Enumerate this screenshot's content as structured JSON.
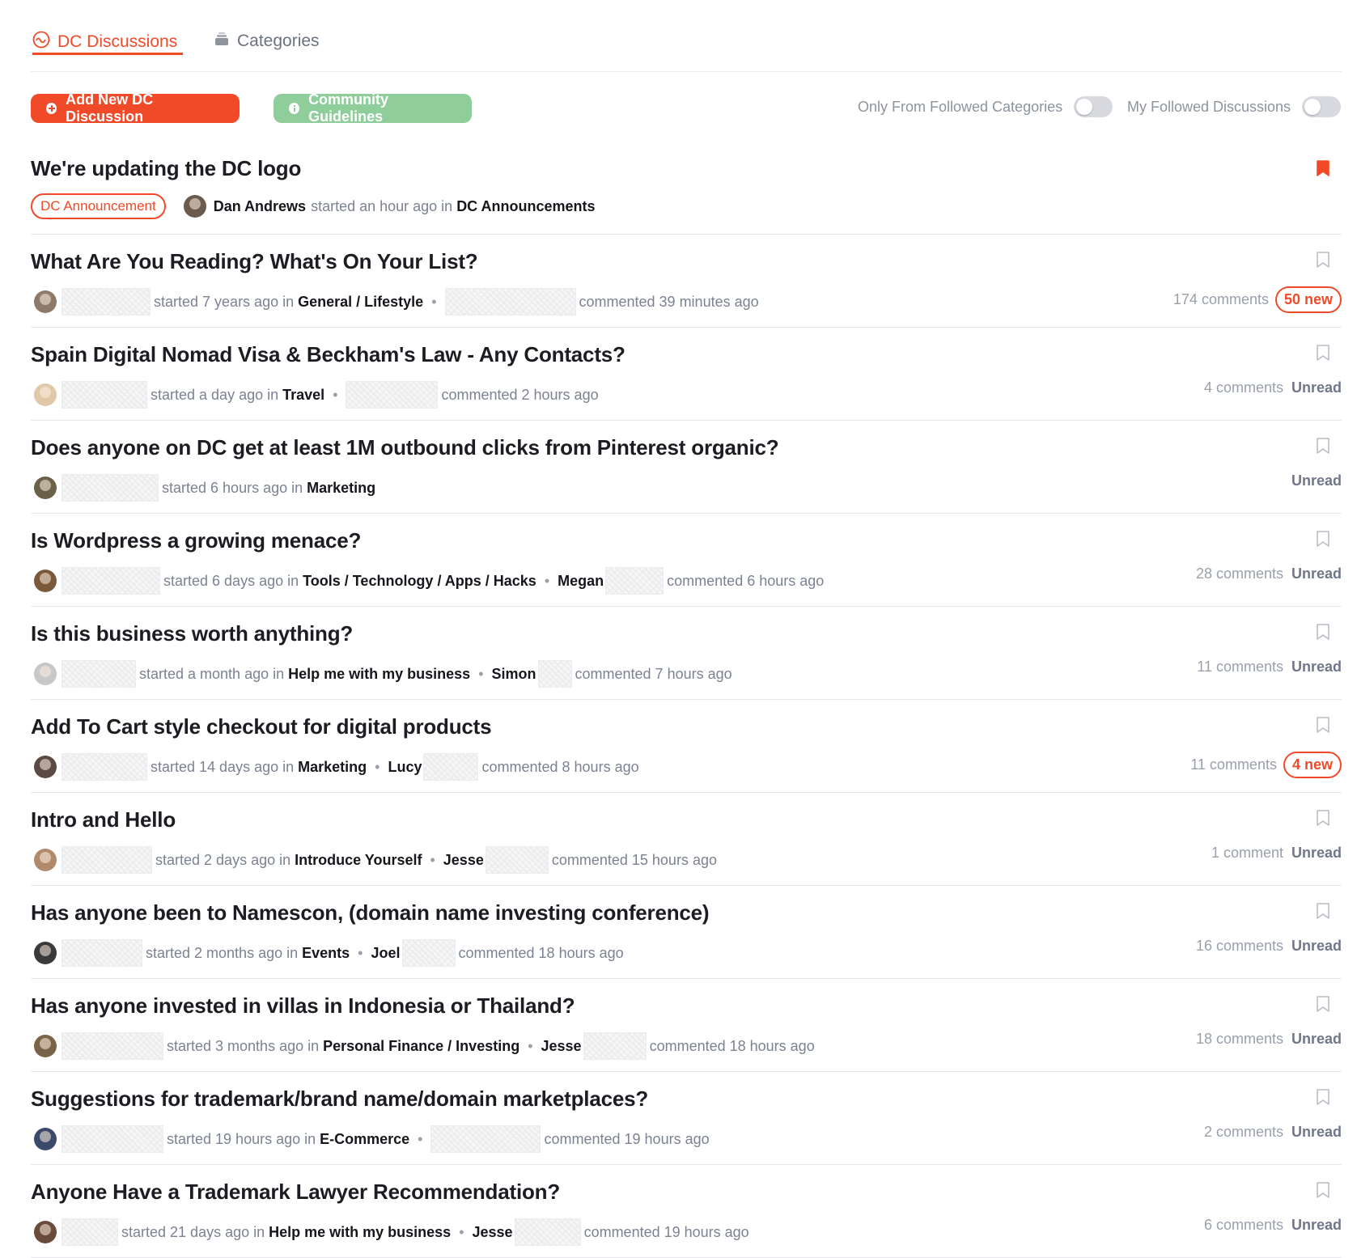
{
  "tabs": [
    {
      "label": "DC Discussions",
      "icon": "dc-logo-icon",
      "active": true
    },
    {
      "label": "Categories",
      "icon": "categories-icon",
      "active": false
    }
  ],
  "actions": {
    "add_label": "Add New DC Discussion",
    "guidelines_label": "Community Guidelines",
    "toggle_followed_categories": "Only From Followed Categories",
    "toggle_followed_discussions": "My Followed Discussions"
  },
  "colors": {
    "accent": "#f04a28",
    "guidelines": "#8fcd9b",
    "muted": "#7b8291"
  },
  "discussions": [
    {
      "title": "We're updating the DC logo",
      "tag": "DC Announcement",
      "author": "Dan Andrews",
      "started": "started an hour ago in",
      "category": "DC Announcements",
      "bookmarked": true
    },
    {
      "title": "What Are You Reading? What's On Your List?",
      "started": "started 7 years ago in",
      "category": "General / Lifestyle",
      "commenter": "",
      "commented": "commented 39 minutes ago",
      "comments": "174 comments",
      "status": "50 new"
    },
    {
      "title": "Spain Digital Nomad Visa & Beckham's Law - Any Contacts?",
      "started": "started a day ago in",
      "category": "Travel",
      "commenter": "",
      "commented": "commented 2 hours ago",
      "comments": "4 comments",
      "status": "Unread"
    },
    {
      "title": "Does anyone on DC get at least 1M outbound clicks from Pinterest organic?",
      "started": "started 6 hours ago in",
      "category": "Marketing",
      "comments": "",
      "status": "Unread"
    },
    {
      "title": "Is Wordpress a growing menace?",
      "started": "started 6 days ago in",
      "category": "Tools / Technology / Apps / Hacks",
      "commenter": "Megan",
      "commented": "commented 6 hours ago",
      "comments": "28 comments",
      "status": "Unread"
    },
    {
      "title": "Is this business worth anything?",
      "started": "started a month ago in",
      "category": "Help me with my business",
      "commenter": "Simon",
      "commented": "commented 7 hours ago",
      "comments": "11 comments",
      "status": "Unread"
    },
    {
      "title": "Add To Cart style checkout for digital products",
      "started": "started 14 days ago in",
      "category": "Marketing",
      "commenter": "Lucy",
      "commented": "commented 8 hours ago",
      "comments": "11 comments",
      "status": "4 new"
    },
    {
      "title": "Intro and Hello",
      "started": "started 2 days ago in",
      "category": "Introduce Yourself",
      "commenter": "Jesse",
      "commented": "commented 15 hours ago",
      "comments": "1 comment",
      "status": "Unread"
    },
    {
      "title": "Has anyone been to Namescon, (domain name investing conference)",
      "started": "started 2 months ago in",
      "category": "Events",
      "commenter": "Joel",
      "commented": "commented 18 hours ago",
      "comments": "16 comments",
      "status": "Unread"
    },
    {
      "title": "Has anyone invested in villas in Indonesia or Thailand?",
      "started": "started 3 months ago in",
      "category": "Personal Finance / Investing",
      "commenter": "Jesse",
      "commented": "commented 18 hours ago",
      "comments": "18 comments",
      "status": "Unread"
    },
    {
      "title": "Suggestions for trademark/brand name/domain marketplaces?",
      "started": "started 19 hours ago in",
      "category": "E-Commerce",
      "commenter": "",
      "commented": "commented 19 hours ago",
      "comments": "2 comments",
      "status": "Unread"
    },
    {
      "title": "Anyone Have a Trademark Lawyer Recommendation?",
      "started": "started 21 days ago in",
      "category": "Help me with my business",
      "commenter": "Jesse",
      "commented": "commented 19 hours ago",
      "comments": "6 comments",
      "status": "Unread"
    }
  ]
}
